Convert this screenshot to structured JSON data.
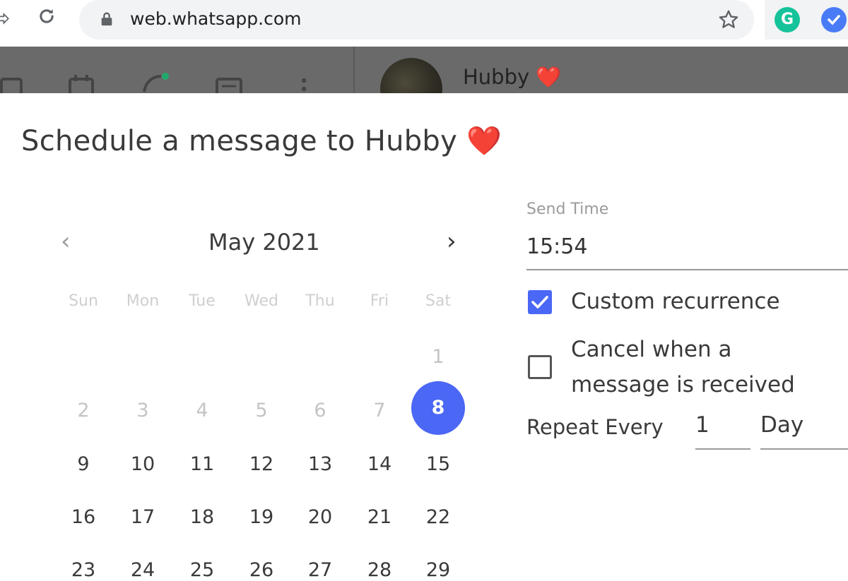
{
  "browser": {
    "url": "web.whatsapp.com",
    "forward_glyph": "⇨",
    "extension_g_letter": "G"
  },
  "chat_header": {
    "contact_name": "Hubby ❤️"
  },
  "dialog": {
    "title": "Schedule a message to Hubby ❤️",
    "calendar": {
      "month_label": "May 2021",
      "prev_glyph": "‹",
      "next_glyph": "›",
      "weekdays": [
        "Sun",
        "Mon",
        "Tue",
        "Wed",
        "Thu",
        "Fri",
        "Sat"
      ],
      "days": [
        [
          "",
          "",
          "",
          "",
          "",
          "",
          "1"
        ],
        [
          "2",
          "3",
          "4",
          "5",
          "6",
          "7",
          "8"
        ],
        [
          "9",
          "10",
          "11",
          "12",
          "13",
          "14",
          "15"
        ],
        [
          "16",
          "17",
          "18",
          "19",
          "20",
          "21",
          "22"
        ],
        [
          "23",
          "24",
          "25",
          "26",
          "27",
          "28",
          "29"
        ]
      ],
      "selected_day": "8",
      "accent_color": "#4a67f5"
    },
    "send_time": {
      "label": "Send Time",
      "value": "15:54"
    },
    "custom_recurrence": {
      "label": "Custom recurrence",
      "checked": true
    },
    "cancel_on_receive": {
      "label_line1": "Cancel when a",
      "label_line2": "message is received",
      "checked": false
    },
    "repeat": {
      "label": "Repeat Every",
      "number": "1",
      "unit": "Day"
    }
  }
}
